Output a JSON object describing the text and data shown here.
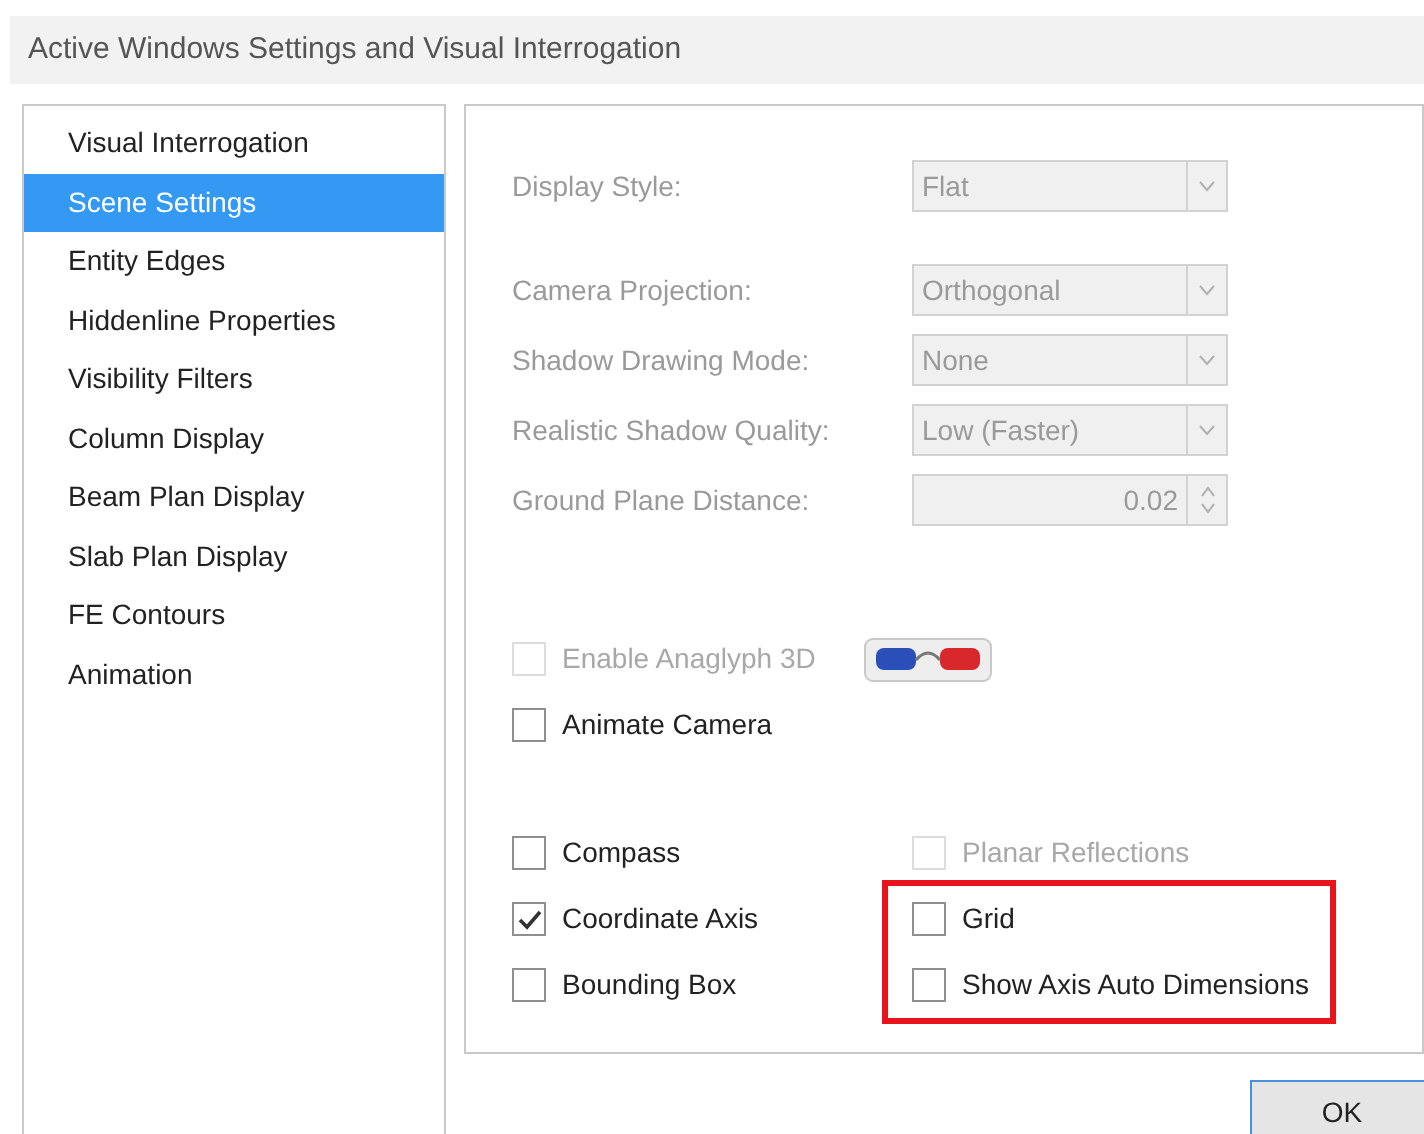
{
  "window": {
    "title": "Active Windows Settings and Visual Interrogation"
  },
  "sidebar": {
    "items": [
      {
        "label": "Visual Interrogation",
        "selected": false
      },
      {
        "label": "Scene Settings",
        "selected": true
      },
      {
        "label": "Entity Edges",
        "selected": false
      },
      {
        "label": "Hiddenline Properties",
        "selected": false
      },
      {
        "label": "Visibility Filters",
        "selected": false
      },
      {
        "label": "Column Display",
        "selected": false
      },
      {
        "label": "Beam Plan Display",
        "selected": false
      },
      {
        "label": "Slab Plan Display",
        "selected": false
      },
      {
        "label": "FE Contours",
        "selected": false
      },
      {
        "label": "Animation",
        "selected": false
      }
    ]
  },
  "field_groups": [
    {
      "fields": [
        {
          "kind": "dropdown",
          "label": "Display Style:",
          "value": "Flat",
          "disabled": true
        }
      ]
    },
    {
      "fields": [
        {
          "kind": "dropdown",
          "label": "Camera Projection:",
          "value": "Orthogonal",
          "disabled": true
        },
        {
          "kind": "dropdown",
          "label": "Shadow Drawing Mode:",
          "value": "None",
          "disabled": true
        },
        {
          "kind": "dropdown",
          "label": "Realistic Shadow Quality:",
          "value": "Low (Faster)",
          "disabled": true
        },
        {
          "kind": "spinner",
          "label": "Ground Plane Distance:",
          "value": "0.02",
          "disabled": true
        }
      ]
    }
  ],
  "options": [
    {
      "label": "Enable Anaglyph 3D",
      "checked": false,
      "disabled": true
    },
    {
      "label": "Animate Camera",
      "checked": false,
      "disabled": false
    }
  ],
  "display_options": {
    "left": [
      {
        "label": "Compass",
        "checked": false,
        "disabled": false,
        "highlighted": false
      },
      {
        "label": "Coordinate Axis",
        "checked": true,
        "disabled": false,
        "highlighted": false
      },
      {
        "label": "Bounding Box",
        "checked": false,
        "disabled": false,
        "highlighted": false
      }
    ],
    "right": [
      {
        "label": "Planar Reflections",
        "checked": false,
        "disabled": true,
        "highlighted": false
      },
      {
        "label": "Grid",
        "checked": false,
        "disabled": false,
        "highlighted": true
      },
      {
        "label": "Show Axis Auto Dimensions",
        "checked": false,
        "disabled": false,
        "highlighted": true
      }
    ]
  },
  "buttons": [
    {
      "label": "OK"
    }
  ]
}
